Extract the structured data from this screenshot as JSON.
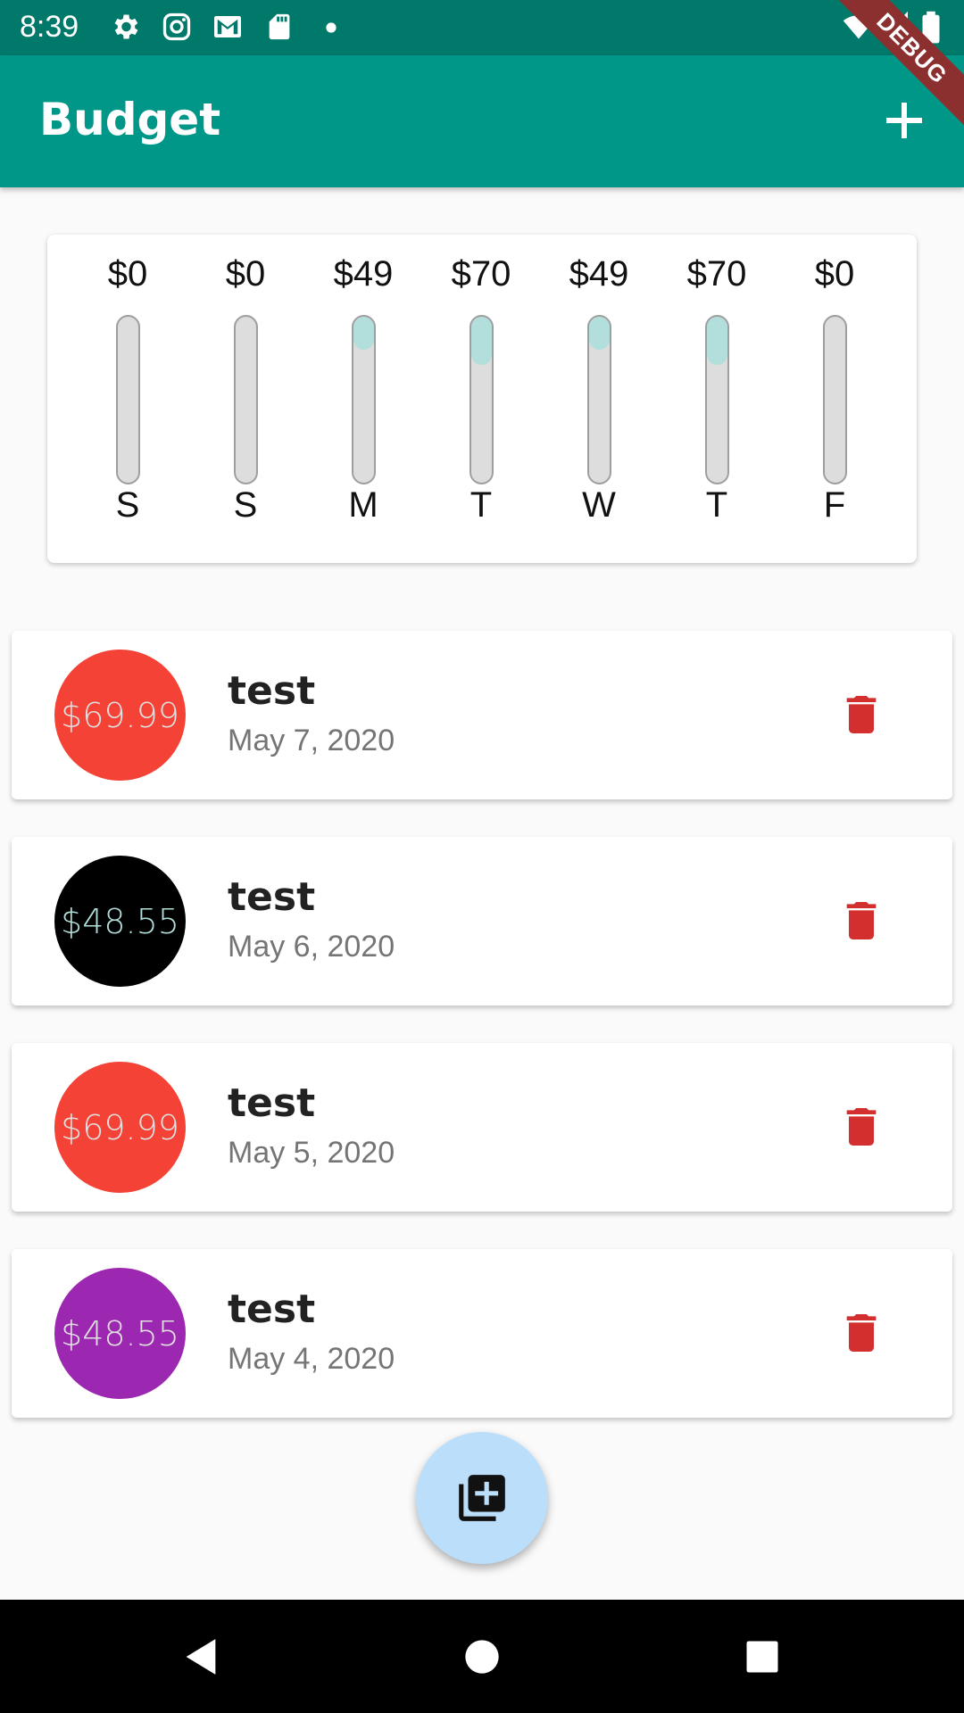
{
  "status_bar": {
    "time": "8:39",
    "debug_label": "DEBUG",
    "left_icons": [
      "gear-icon",
      "instagram-icon",
      "gmail-icon",
      "sd-card-icon",
      "dot-icon"
    ],
    "right_icons": [
      "wifi-icon",
      "signal-icon",
      "battery-icon"
    ]
  },
  "app_bar": {
    "title": "Budget",
    "add_icon": "plus-icon",
    "background": "#009688"
  },
  "chart": {
    "bars": [
      {
        "day": "S",
        "amount": "$0",
        "fill": 0.0
      },
      {
        "day": "S",
        "amount": "$0",
        "fill": 0.0
      },
      {
        "day": "M",
        "amount": "$49",
        "fill": 0.2
      },
      {
        "day": "T",
        "amount": "$70",
        "fill": 0.29
      },
      {
        "day": "W",
        "amount": "$49",
        "fill": 0.2
      },
      {
        "day": "T",
        "amount": "$70",
        "fill": 0.29
      },
      {
        "day": "F",
        "amount": "$0",
        "fill": 0.0
      }
    ],
    "fill_color": "#b2dfdb",
    "track_color": "#dddddd"
  },
  "transactions": [
    {
      "amount": "$69.99",
      "title": "test",
      "date": "May 7, 2020",
      "color": "#f44336",
      "text_color": "#e0e0e0"
    },
    {
      "amount": "$48.55",
      "title": "test",
      "date": "May 6, 2020",
      "color": "#000000",
      "text_color": "#b2dfdb"
    },
    {
      "amount": "$69.99",
      "title": "test",
      "date": "May 5, 2020",
      "color": "#f44336",
      "text_color": "#e0e0e0"
    },
    {
      "amount": "$48.55",
      "title": "test",
      "date": "May 4, 2020",
      "color": "#9c27b0",
      "text_color": "#e0e0e0"
    }
  ],
  "delete_icon": "trash-icon",
  "delete_color": "#d32f2f",
  "fab": {
    "icon": "add-to-queue-icon",
    "color": "#bbdefb"
  },
  "nav": {
    "back_icon": "back-triangle-icon",
    "home_icon": "home-circle-icon",
    "recents_icon": "recents-square-icon"
  }
}
